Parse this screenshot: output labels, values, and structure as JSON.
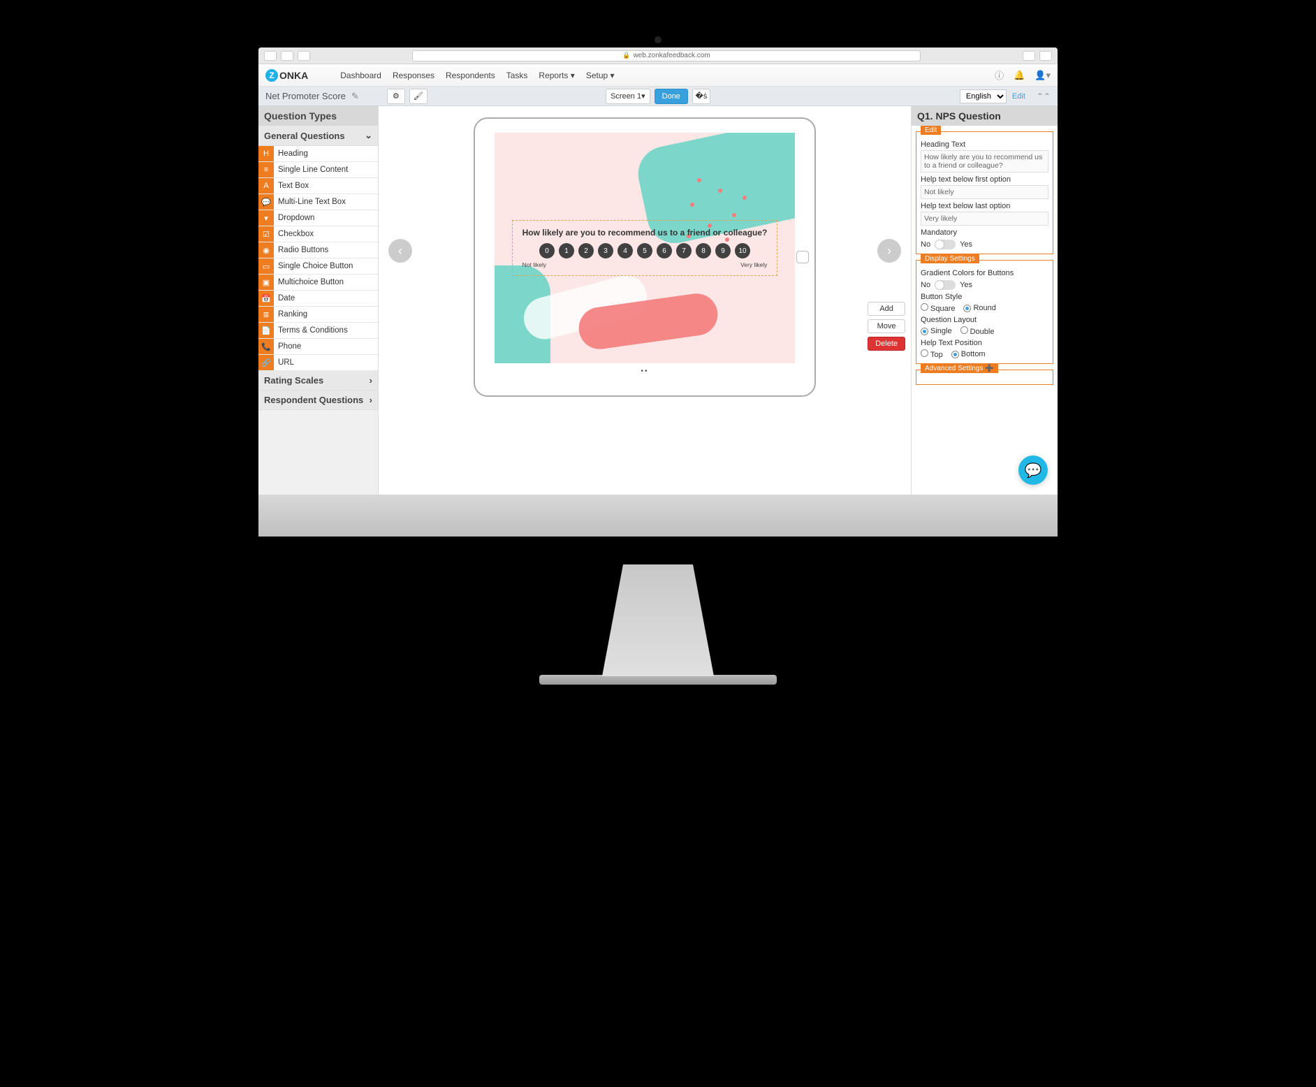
{
  "browser": {
    "url": "web.zonkafeedback.com"
  },
  "logo": {
    "name": "ONKA",
    "badge": "Z"
  },
  "nav": [
    "Dashboard",
    "Responses",
    "Respondents",
    "Tasks",
    "Reports",
    "Setup"
  ],
  "nav_dropdown": {
    "reports": "▾",
    "setup": "▾"
  },
  "subbar": {
    "survey_name": "Net Promoter Score",
    "screen": "Screen 1",
    "done": "Done",
    "language": "English",
    "edit": "Edit"
  },
  "left": {
    "title": "Question Types",
    "sections": {
      "general": "General Questions",
      "rating": "Rating Scales",
      "respondent": "Respondent Questions"
    },
    "general_items": [
      {
        "icon": "H",
        "label": "Heading"
      },
      {
        "icon": "≡",
        "label": "Single Line Content"
      },
      {
        "icon": "A",
        "label": "Text Box"
      },
      {
        "icon": "💬",
        "label": "Multi-Line Text Box"
      },
      {
        "icon": "▾",
        "label": "Dropdown"
      },
      {
        "icon": "☑",
        "label": "Checkbox"
      },
      {
        "icon": "◉",
        "label": "Radio Buttons"
      },
      {
        "icon": "▭",
        "label": "Single Choice Button"
      },
      {
        "icon": "▣",
        "label": "Multichoice Button"
      },
      {
        "icon": "📅",
        "label": "Date"
      },
      {
        "icon": "≣",
        "label": "Ranking"
      },
      {
        "icon": "📄",
        "label": "Terms & Conditions"
      },
      {
        "icon": "📞",
        "label": "Phone"
      },
      {
        "icon": "🔗",
        "label": "URL"
      }
    ]
  },
  "canvas": {
    "question": "How likely are you to recommend us to a friend or colleague?",
    "scale": [
      "0",
      "1",
      "2",
      "3",
      "4",
      "5",
      "6",
      "7",
      "8",
      "9",
      "10"
    ],
    "left_label": "Not likely",
    "right_label": "Very likely",
    "actions": {
      "add": "Add",
      "move": "Move",
      "delete": "Delete"
    }
  },
  "right": {
    "title": "Q1. NPS Question",
    "edit": {
      "legend": "Edit",
      "heading_label": "Heading Text",
      "heading_value": "How likely are you to recommend us to a friend or colleague?",
      "help_first_label": "Help text below first option",
      "help_first_value": "Not likely",
      "help_last_label": "Help text below last option",
      "help_last_value": "Very likely",
      "mandatory_label": "Mandatory",
      "no": "No",
      "yes": "Yes"
    },
    "display": {
      "legend": "Display Settings",
      "gradient_label": "Gradient Colors for Buttons",
      "no": "No",
      "yes": "Yes",
      "style_label": "Button Style",
      "square": "Square",
      "round": "Round",
      "layout_label": "Question Layout",
      "single": "Single",
      "double": "Double",
      "help_pos_label": "Help Text Position",
      "top": "Top",
      "bottom": "Bottom"
    },
    "advanced": {
      "legend": "Advanced Settings ➕"
    }
  }
}
